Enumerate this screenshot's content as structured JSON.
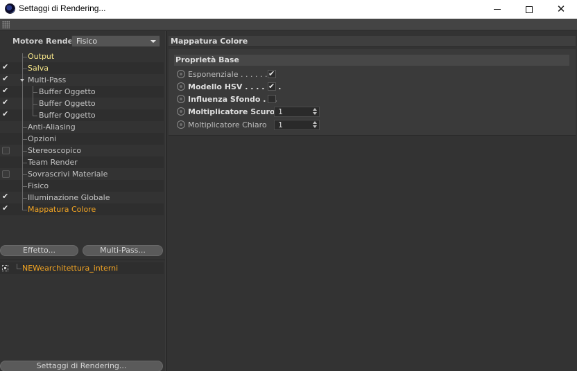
{
  "window": {
    "title": "Settaggi di Rendering...",
    "controls": {
      "minimize": "minimize-icon",
      "maximize": "maximize-icon",
      "close": "close-icon"
    }
  },
  "engine": {
    "label": "Motore Render",
    "value": "Fisico"
  },
  "tree": [
    {
      "label": "Output",
      "checkbox": "none",
      "color": "yellow"
    },
    {
      "label": "Salva",
      "checkbox": "checked",
      "color": "yellow"
    },
    {
      "label": "Multi-Pass",
      "checkbox": "checked",
      "color": "normal",
      "expanded": true
    },
    {
      "label": "Buffer Oggetto",
      "checkbox": "checked",
      "color": "normal",
      "child": true
    },
    {
      "label": "Buffer Oggetto",
      "checkbox": "checked",
      "color": "normal",
      "child": true
    },
    {
      "label": "Buffer Oggetto",
      "checkbox": "checked",
      "color": "normal",
      "child": true
    },
    {
      "label": "Anti-Aliasing",
      "checkbox": "none",
      "color": "normal"
    },
    {
      "label": "Opzioni",
      "checkbox": "none",
      "color": "normal"
    },
    {
      "label": "Stereoscopico",
      "checkbox": "unchecked",
      "color": "normal"
    },
    {
      "label": "Team Render",
      "checkbox": "none",
      "color": "normal"
    },
    {
      "label": "Sovrascrivi Materiale",
      "checkbox": "unchecked",
      "color": "normal"
    },
    {
      "label": "Fisico",
      "checkbox": "none",
      "color": "normal"
    },
    {
      "label": "Illuminazione Globale",
      "checkbox": "checked",
      "color": "normal"
    },
    {
      "label": "Mappatura Colore",
      "checkbox": "checked",
      "color": "orange"
    }
  ],
  "buttons": {
    "effect": "Effetto...",
    "multipass": "Multi-Pass...",
    "render_settings": "Settaggi di Rendering..."
  },
  "preset": {
    "label": "NEWearchitettura_interni"
  },
  "panel": {
    "title": "Mappatura Colore",
    "group_title": "Proprietà Base",
    "params": [
      {
        "label": "Esponenziale",
        "dots": " . . . . . . .",
        "bold": false,
        "type": "checkbox",
        "checked": true
      },
      {
        "label": "Modello HSV",
        "dots": " . . . . . . .",
        "bold": true,
        "type": "checkbox",
        "checked": true
      },
      {
        "label": "Influenza Sfondo",
        "dots": " . . .",
        "bold": true,
        "type": "checkbox",
        "checked": false
      },
      {
        "label": "Moltiplicatore Scuro",
        "dots": "",
        "bold": true,
        "type": "number",
        "value": "1"
      },
      {
        "label": "Moltiplicatore Chiaro",
        "dots": "",
        "bold": false,
        "type": "number",
        "value": "1"
      }
    ]
  }
}
